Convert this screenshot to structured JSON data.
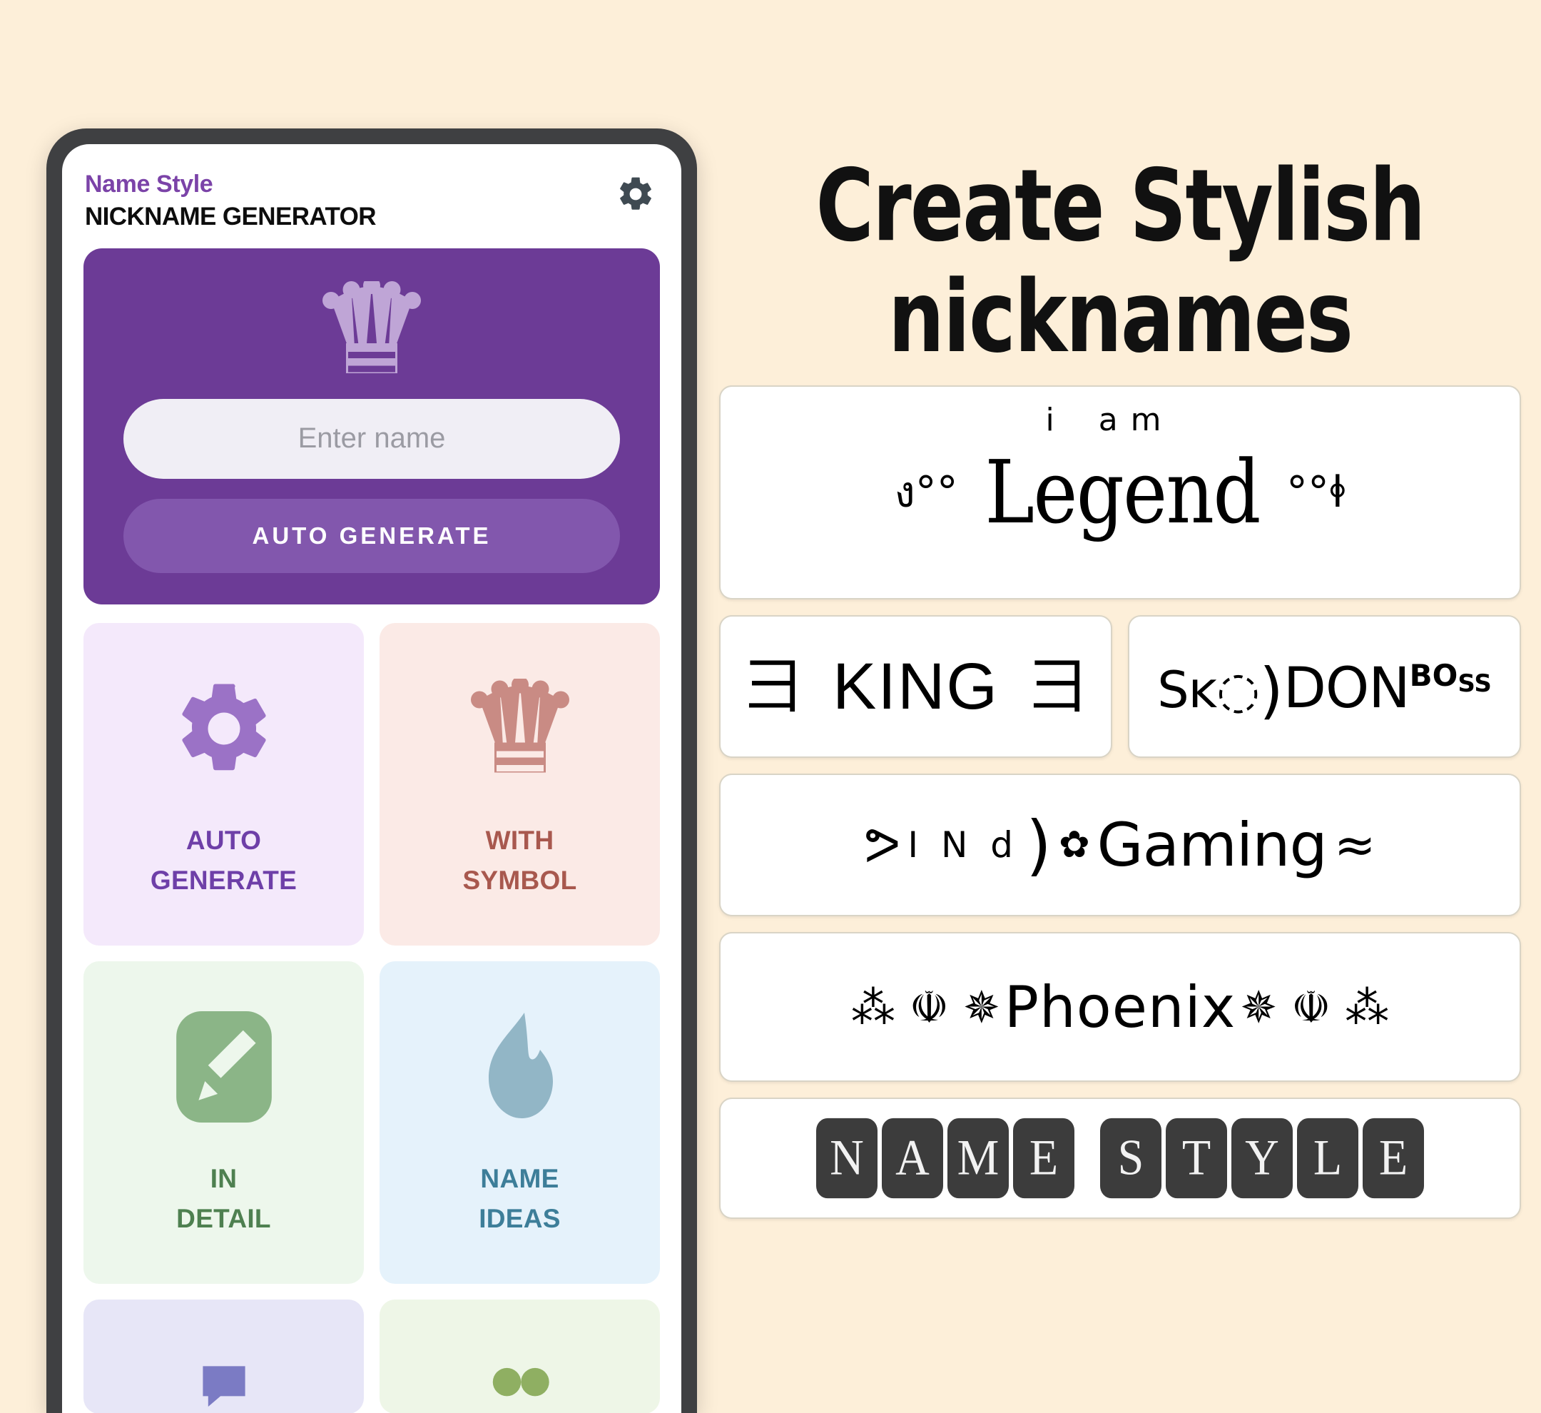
{
  "background_color": "#FDEFD9",
  "phone": {
    "header": {
      "brand": "Name Style",
      "subtitle": "NICKNAME GENERATOR",
      "settings_icon": "gear-icon"
    },
    "hero": {
      "icon": "crown-icon",
      "background_color": "#6C3B96",
      "input_placeholder": "Enter name",
      "input_value": "",
      "button_label": "AUTO GENERATE"
    },
    "tiles": [
      {
        "icon": "gear-icon",
        "line1": "AUTO",
        "line2": "GENERATE",
        "bg": "#F4E9FB",
        "fg": "#6E3FA8",
        "icon_color": "#9B72C6"
      },
      {
        "icon": "crown-icon",
        "line1": "WITH",
        "line2": "SYMBOL",
        "bg": "#FBEAE6",
        "fg": "#A8584E",
        "icon_color": "#C98B84"
      },
      {
        "icon": "pencil-icon",
        "line1": "IN",
        "line2": "DETAIL",
        "bg": "#EDF7EC",
        "fg": "#4E8050",
        "icon_color": "#8BB587"
      },
      {
        "icon": "flame-icon",
        "line1": "NAME",
        "line2": "IDEAS",
        "bg": "#E5F2FB",
        "fg": "#3D7E99",
        "icon_color": "#92B6C6"
      },
      {
        "icon": "",
        "line1": "",
        "line2": "",
        "bg": "#E7E6F7",
        "fg": "#5A5AA8",
        "icon_color": "#7B7BC4"
      },
      {
        "icon": "",
        "line1": "",
        "line2": "",
        "bg": "#EEF6E7",
        "fg": "#6E8F4B",
        "icon_color": "#8FAF62"
      }
    ]
  },
  "showcase": {
    "headline_line1": "Create Stylish",
    "headline_line2": "nicknames",
    "samples": {
      "legend": {
        "sup_left": "i",
        "sup_right": "a m",
        "ornament_left": "ง°°",
        "text": "Legend",
        "ornament_right": "°°ꬹ"
      },
      "king": {
        "ornament_left": "彐",
        "text": "KING",
        "ornament_right": "彐"
      },
      "skdon": {
        "part_a": "Sĸ",
        "ornament": "◌",
        "curl": ")",
        "part_b": "DON",
        "sup_a": "BO",
        "sup_b": "SS"
      },
      "gaming": {
        "ornament_left": "ᕗ",
        "prefix": "I N d",
        "curl": ")",
        "flower": "✿",
        "text": "Gaming",
        "ornament_right": "≈"
      },
      "phoenix": {
        "ornament_left": "⁂ ☫ ✵",
        "text": "Phoenix",
        "ornament_right": "✵ ☫ ⁂"
      },
      "namestyle": {
        "word1": "NAME",
        "word2": "STYLE"
      }
    }
  }
}
